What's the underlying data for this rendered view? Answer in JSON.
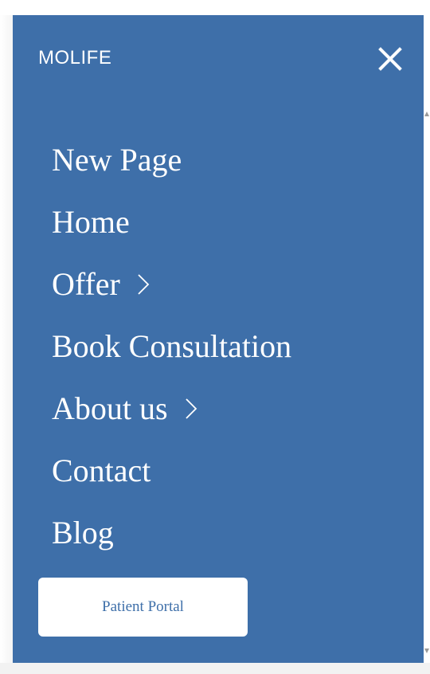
{
  "brand": {
    "name": "MOLIFE"
  },
  "close_button": {
    "icon": "close-icon"
  },
  "nav": {
    "items": [
      {
        "label": "New Page",
        "has_submenu": false
      },
      {
        "label": "Home",
        "has_submenu": false
      },
      {
        "label": "Offer",
        "has_submenu": true
      },
      {
        "label": "Book Consultation",
        "has_submenu": false
      },
      {
        "label": "About us",
        "has_submenu": true
      },
      {
        "label": "Contact",
        "has_submenu": false
      },
      {
        "label": "Blog",
        "has_submenu": false
      }
    ]
  },
  "portal_button": {
    "label": "Patient Portal"
  },
  "colors": {
    "panel_background": "#3e6fa9",
    "text": "#ffffff",
    "button_background": "#ffffff",
    "button_text": "#3e6fa9"
  }
}
